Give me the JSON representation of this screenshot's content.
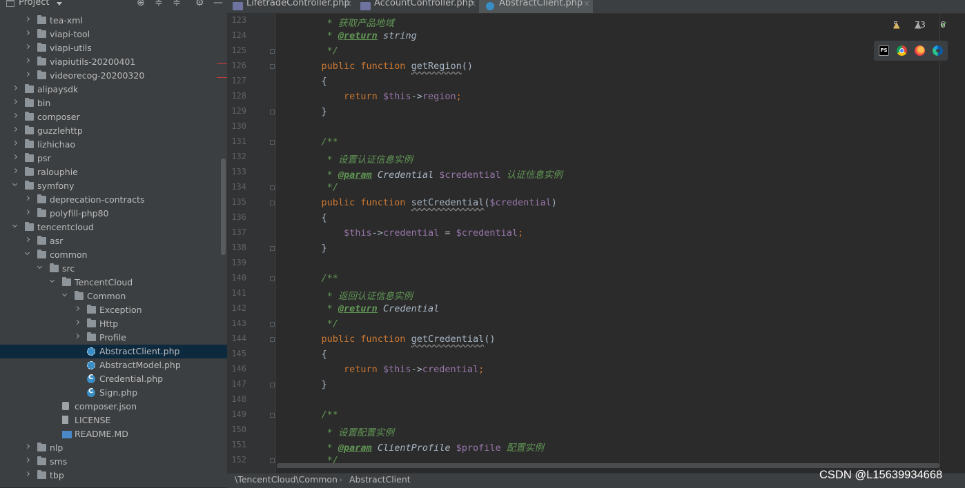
{
  "project_panel": {
    "title": "Project",
    "tree": [
      {
        "label": "tea-xml",
        "depth": 3,
        "kind": "folder",
        "state": "closed"
      },
      {
        "label": "viapi-tool",
        "depth": 3,
        "kind": "folder",
        "state": "closed"
      },
      {
        "label": "viapi-utils",
        "depth": 3,
        "kind": "folder",
        "state": "closed"
      },
      {
        "label": "viapiutils-20200401",
        "depth": 3,
        "kind": "folder",
        "state": "closed"
      },
      {
        "label": "videorecog-20200320",
        "depth": 3,
        "kind": "folder",
        "state": "closed"
      },
      {
        "label": "alipaysdk",
        "depth": 2,
        "kind": "folder",
        "state": "closed"
      },
      {
        "label": "bin",
        "depth": 2,
        "kind": "folder",
        "state": "closed"
      },
      {
        "label": "composer",
        "depth": 2,
        "kind": "folder",
        "state": "closed"
      },
      {
        "label": "guzzlehttp",
        "depth": 2,
        "kind": "folder",
        "state": "closed"
      },
      {
        "label": "lizhichao",
        "depth": 2,
        "kind": "folder",
        "state": "closed"
      },
      {
        "label": "psr",
        "depth": 2,
        "kind": "folder",
        "state": "closed"
      },
      {
        "label": "ralouphie",
        "depth": 2,
        "kind": "folder",
        "state": "closed"
      },
      {
        "label": "symfony",
        "depth": 2,
        "kind": "folder",
        "state": "open"
      },
      {
        "label": "deprecation-contracts",
        "depth": 3,
        "kind": "folder",
        "state": "closed"
      },
      {
        "label": "polyfill-php80",
        "depth": 3,
        "kind": "folder",
        "state": "closed"
      },
      {
        "label": "tencentcloud",
        "depth": 2,
        "kind": "folder",
        "state": "open"
      },
      {
        "label": "asr",
        "depth": 3,
        "kind": "folder",
        "state": "closed"
      },
      {
        "label": "common",
        "depth": 3,
        "kind": "folder",
        "state": "open"
      },
      {
        "label": "src",
        "depth": 4,
        "kind": "folder",
        "state": "open"
      },
      {
        "label": "TencentCloud",
        "depth": 5,
        "kind": "folder",
        "state": "open"
      },
      {
        "label": "Common",
        "depth": 6,
        "kind": "folder",
        "state": "open"
      },
      {
        "label": "Exception",
        "depth": 7,
        "kind": "folder",
        "state": "closed"
      },
      {
        "label": "Http",
        "depth": 7,
        "kind": "folder",
        "state": "closed"
      },
      {
        "label": "Profile",
        "depth": 7,
        "kind": "folder",
        "state": "closed"
      },
      {
        "label": "AbstractClient.php",
        "depth": 7,
        "kind": "phpa",
        "state": "none",
        "selected": true
      },
      {
        "label": "AbstractModel.php",
        "depth": 7,
        "kind": "phpa",
        "state": "none"
      },
      {
        "label": "Credential.php",
        "depth": 7,
        "kind": "phpc",
        "state": "none"
      },
      {
        "label": "Sign.php",
        "depth": 7,
        "kind": "phpc",
        "state": "none"
      },
      {
        "label": "composer.json",
        "depth": 5,
        "kind": "json",
        "state": "none"
      },
      {
        "label": "LICENSE",
        "depth": 5,
        "kind": "file",
        "state": "none"
      },
      {
        "label": "README.MD",
        "depth": 5,
        "kind": "md",
        "state": "none"
      },
      {
        "label": "nlp",
        "depth": 3,
        "kind": "folder",
        "state": "closed"
      },
      {
        "label": "sms",
        "depth": 3,
        "kind": "folder",
        "state": "closed"
      },
      {
        "label": "tbp",
        "depth": 3,
        "kind": "folder",
        "state": "closed"
      }
    ]
  },
  "tabs": [
    {
      "label": "LifetradeController.php",
      "icon": "php-file-icon",
      "active": false
    },
    {
      "label": "AccountController.php",
      "icon": "php-file-icon",
      "active": false
    },
    {
      "label": "AbstractClient.php",
      "icon": "php-class-icon",
      "active": true
    }
  ],
  "editor": {
    "first_line": 123,
    "lines": [
      [
        {
          "t": "     * ",
          "c": "doc"
        },
        {
          "t": "获取产品地域",
          "c": "doc"
        }
      ],
      [
        {
          "t": "     * ",
          "c": "doc"
        },
        {
          "t": "@return",
          "c": "tag"
        },
        {
          "t": " string",
          "c": "typ"
        }
      ],
      [
        {
          "t": "     */",
          "c": "doc"
        }
      ],
      [
        {
          "t": "    public function ",
          "c": "kw"
        },
        {
          "t": "getRegion",
          "c": "fnu"
        },
        {
          "t": "()",
          "c": ""
        }
      ],
      [
        {
          "t": "    {",
          "c": ""
        }
      ],
      [
        {
          "t": "        return ",
          "c": "kw"
        },
        {
          "t": "$this",
          "c": "var"
        },
        {
          "t": "->",
          "c": ""
        },
        {
          "t": "region",
          "c": "prop"
        },
        {
          "t": ";",
          "c": "pun"
        }
      ],
      [
        {
          "t": "    }",
          "c": ""
        }
      ],
      [],
      [
        {
          "t": "    /**",
          "c": "doc"
        }
      ],
      [
        {
          "t": "     * ",
          "c": "doc"
        },
        {
          "t": "设置认证信息实例",
          "c": "doc"
        }
      ],
      [
        {
          "t": "     * ",
          "c": "doc"
        },
        {
          "t": "@param",
          "c": "tag"
        },
        {
          "t": " Credential ",
          "c": "typ"
        },
        {
          "t": "$credential",
          "c": "var"
        },
        {
          "t": " 认证信息实例",
          "c": "doc"
        }
      ],
      [
        {
          "t": "     */",
          "c": "doc"
        }
      ],
      [
        {
          "t": "    public function ",
          "c": "kw"
        },
        {
          "t": "setCredential",
          "c": "fnu"
        },
        {
          "t": "(",
          "c": ""
        },
        {
          "t": "$credential",
          "c": "var"
        },
        {
          "t": ")",
          "c": ""
        }
      ],
      [
        {
          "t": "    {",
          "c": ""
        }
      ],
      [
        {
          "t": "        $this",
          "c": "var"
        },
        {
          "t": "->",
          "c": ""
        },
        {
          "t": "credential",
          "c": "prop"
        },
        {
          "t": " = ",
          "c": ""
        },
        {
          "t": "$credential",
          "c": "var"
        },
        {
          "t": ";",
          "c": "pun"
        }
      ],
      [
        {
          "t": "    }",
          "c": ""
        }
      ],
      [],
      [
        {
          "t": "    /**",
          "c": "doc"
        }
      ],
      [
        {
          "t": "     * ",
          "c": "doc"
        },
        {
          "t": "返回认证信息实例",
          "c": "doc"
        }
      ],
      [
        {
          "t": "     * ",
          "c": "doc"
        },
        {
          "t": "@return",
          "c": "tag"
        },
        {
          "t": " Credential",
          "c": "typ"
        }
      ],
      [
        {
          "t": "     */",
          "c": "doc"
        }
      ],
      [
        {
          "t": "    public function ",
          "c": "kw"
        },
        {
          "t": "getCredential",
          "c": "fnu"
        },
        {
          "t": "()",
          "c": ""
        }
      ],
      [
        {
          "t": "    {",
          "c": ""
        }
      ],
      [
        {
          "t": "        return ",
          "c": "kw"
        },
        {
          "t": "$this",
          "c": "var"
        },
        {
          "t": "->",
          "c": ""
        },
        {
          "t": "credential",
          "c": "prop"
        },
        {
          "t": ";",
          "c": "pun"
        }
      ],
      [
        {
          "t": "    }",
          "c": ""
        }
      ],
      [],
      [
        {
          "t": "    /**",
          "c": "doc"
        }
      ],
      [
        {
          "t": "     * ",
          "c": "doc"
        },
        {
          "t": "设置配置实例",
          "c": "doc"
        }
      ],
      [
        {
          "t": "     * ",
          "c": "doc"
        },
        {
          "t": "@param",
          "c": "tag"
        },
        {
          "t": " ClientProfile ",
          "c": "typ"
        },
        {
          "t": "$profile",
          "c": "var"
        },
        {
          "t": " 配置实例",
          "c": "doc"
        }
      ],
      [
        {
          "t": "     */",
          "c": "doc"
        }
      ]
    ],
    "fold_lines": [
      125,
      126,
      129,
      131,
      134,
      135,
      138,
      140,
      143,
      144,
      147,
      149,
      152
    ]
  },
  "inspections": {
    "warnings": "5",
    "weak_warnings": "73",
    "ok": "6"
  },
  "browsers": [
    "phpstorm-icon",
    "chrome-icon",
    "firefox-icon",
    "edge-icon"
  ],
  "breadcrumb": {
    "namespace": "\\TencentCloud\\Common",
    "class": "AbstractClient"
  },
  "watermark": "CSDN @L15639934668",
  "colors": {
    "keyword": "#cc7832",
    "doc": "#629755",
    "variable": "#9876aa",
    "selection": "#0d293e"
  }
}
